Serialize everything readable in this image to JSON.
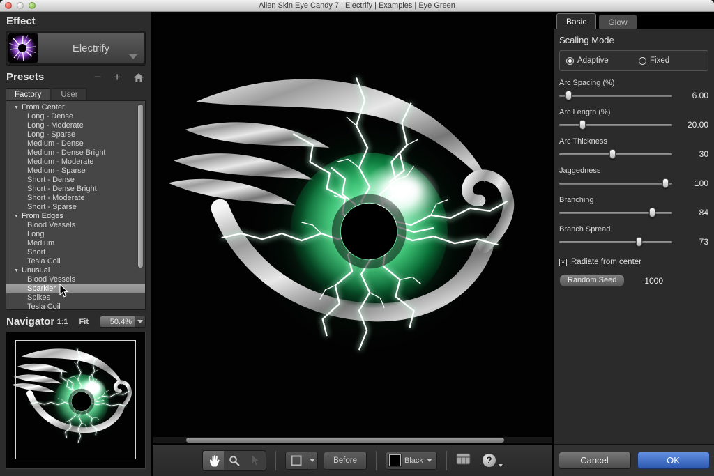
{
  "window": {
    "title": "Alien Skin Eye Candy 7 | Electrify | Examples | Eye Green"
  },
  "icons": {
    "minus": "−",
    "plus": "+",
    "help": "?",
    "checkbox_mark": "×",
    "tree_arrow": "▼"
  },
  "left_panel": {
    "effect": {
      "header": "Effect",
      "button_label": "Electrify"
    },
    "presets": {
      "header": "Presets",
      "tabs": [
        {
          "label": "Factory",
          "active": true
        },
        {
          "label": "User",
          "active": false
        }
      ],
      "tree": [
        {
          "type": "group",
          "label": "From Center"
        },
        {
          "type": "item",
          "label": "Long - Dense"
        },
        {
          "type": "item",
          "label": "Long - Moderate"
        },
        {
          "type": "item",
          "label": "Long - Sparse"
        },
        {
          "type": "item",
          "label": "Medium - Dense"
        },
        {
          "type": "item",
          "label": "Medium - Dense Bright"
        },
        {
          "type": "item",
          "label": "Medium - Moderate"
        },
        {
          "type": "item",
          "label": "Medium - Sparse"
        },
        {
          "type": "item",
          "label": "Short - Dense"
        },
        {
          "type": "item",
          "label": "Short - Dense Bright"
        },
        {
          "type": "item",
          "label": "Short - Moderate"
        },
        {
          "type": "item",
          "label": "Short - Sparse"
        },
        {
          "type": "group",
          "label": "From Edges"
        },
        {
          "type": "item",
          "label": "Blood Vessels"
        },
        {
          "type": "item",
          "label": "Long"
        },
        {
          "type": "item",
          "label": "Medium"
        },
        {
          "type": "item",
          "label": "Short"
        },
        {
          "type": "item",
          "label": "Tesla Coil"
        },
        {
          "type": "group",
          "label": "Unusual"
        },
        {
          "type": "item",
          "label": "Blood Vessels"
        },
        {
          "type": "item",
          "label": "Sparkler",
          "selected": true
        },
        {
          "type": "item",
          "label": "Spikes"
        },
        {
          "type": "item",
          "label": "Tesla Coil"
        }
      ]
    },
    "navigator": {
      "header": "Navigator",
      "actual_size": "1:1",
      "fit": "Fit",
      "zoom": "50.4%"
    }
  },
  "toolbar": {
    "before": "Before",
    "background_color": "Black"
  },
  "right_panel": {
    "tabs": [
      {
        "label": "Basic",
        "active": true
      },
      {
        "label": "Glow",
        "active": false
      }
    ],
    "scaling_mode": {
      "header": "Scaling Mode",
      "options": [
        {
          "label": "Adaptive",
          "selected": true
        },
        {
          "label": "Fixed",
          "selected": false
        }
      ]
    },
    "sliders": [
      {
        "label": "Arc Spacing (%)",
        "value": "6.00",
        "fraction": 0.06
      },
      {
        "label": "Arc Length (%)",
        "value": "20.00",
        "fraction": 0.19
      },
      {
        "label": "Arc Thickness",
        "value": "30",
        "fraction": 0.47
      },
      {
        "label": "Jaggedness",
        "value": "100",
        "fraction": 0.97
      },
      {
        "label": "Branching",
        "value": "84",
        "fraction": 0.84
      },
      {
        "label": "Branch Spread",
        "value": "73",
        "fraction": 0.72
      }
    ],
    "radiate_from_center": {
      "label": "Radiate from center",
      "checked": true
    },
    "random_seed": {
      "button_label": "Random Seed",
      "value": "1000"
    }
  },
  "footer": {
    "cancel": "Cancel",
    "ok": "OK"
  },
  "colors": {
    "ok_button": "#3a67c0",
    "iris_green": "#2ece6e",
    "selection_gray": "#909090",
    "panel_dark": "#2b2b2b"
  }
}
